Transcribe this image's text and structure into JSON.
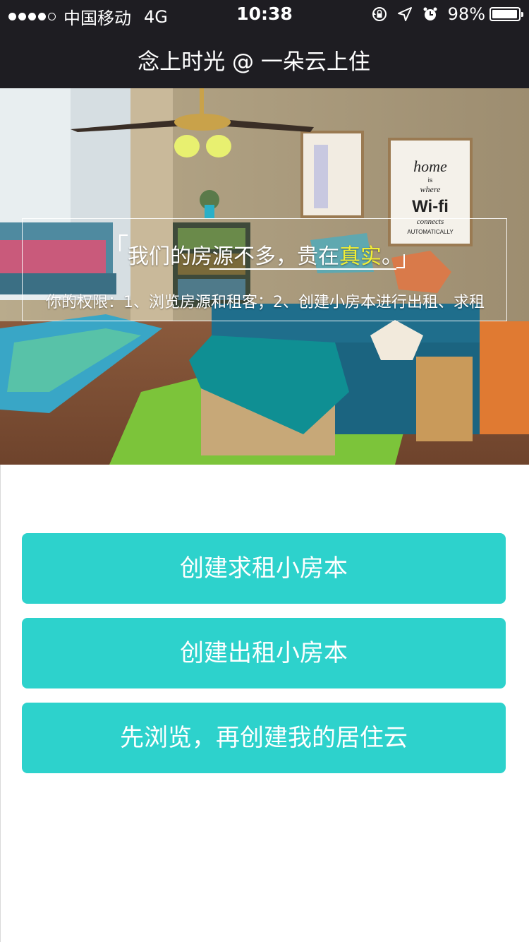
{
  "status_bar": {
    "carrier": "中国移动",
    "network": "4G",
    "time": "10:38",
    "battery_percent": "98%",
    "battery_level": 0.98,
    "signal_bars_filled": 4,
    "icons": [
      "rotation-lock-icon",
      "location-arrow-icon",
      "alarm-icon",
      "battery-icon"
    ]
  },
  "nav": {
    "title": "念上时光 @ 一朵云上住"
  },
  "hero": {
    "caption_before": "我们的房源不多，贵在",
    "caption_highlight": "真实",
    "caption_after": "。",
    "subcaption": "你的权限：1、浏览房源和租客；2、创建小房本进行出租、求租",
    "poster_text": [
      "home",
      "is",
      "where",
      "Wi-fi",
      "connects",
      "AUTOMATICALLY"
    ],
    "highlight_color": "#f3ef34"
  },
  "actions": {
    "create_rent_request": "创建求租小房本",
    "create_rental_listing": "创建出租小房本",
    "browse_first": "先浏览，再创建我的居住云"
  },
  "colors": {
    "bar_background": "#1e1d22",
    "button_background": "#2dd2cc",
    "button_text": "#ffffff"
  }
}
